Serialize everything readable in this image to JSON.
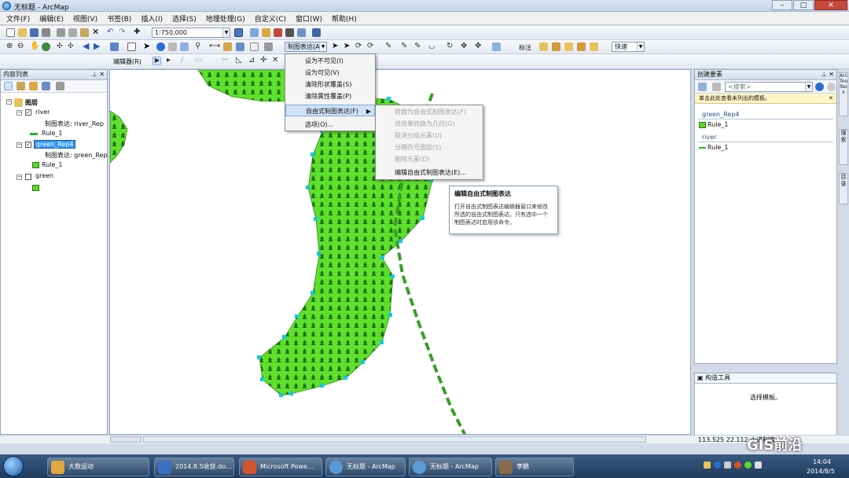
{
  "window": {
    "title": "无标题 - ArcMap"
  },
  "menu": [
    "文件(F)",
    "编辑(E)",
    "视图(V)",
    "书签(B)",
    "插入(I)",
    "选择(S)",
    "地理处理(G)",
    "自定义(C)",
    "窗口(W)",
    "帮助(H)"
  ],
  "toolbar1": {
    "scale": "1:750,000"
  },
  "toolbar2": {
    "representation_menu": "制图表达(A)",
    "label_menu": "标注",
    "label_combo": "快速"
  },
  "toolbar3": {
    "editor_menu": "编辑器(R)"
  },
  "toc": {
    "title": "内容列表",
    "layers_group": "图层",
    "items": [
      {
        "name": "river",
        "sub": "制图表达: river_Rep",
        "rule": "Rule_1",
        "checked": "✓"
      },
      {
        "name": "green_Rep4",
        "sub": "制图表达: green_Rep",
        "rule": "Rule_1",
        "checked": "✓"
      },
      {
        "name": "green",
        "checked": ""
      }
    ]
  },
  "dropdown": {
    "items": [
      "设为不可见(I)",
      "设为可见(V)",
      "清除形状覆盖(S)",
      "清除属性覆盖(P)",
      "自由式制图表达(F)",
      "选项(O)..."
    ]
  },
  "submenu": {
    "items": [
      "转换为自由式制图表达(F)",
      "将效果转换为几何(G)",
      "取消分组元素(U)",
      "分隔符号图层(S)",
      "删除元素(D)",
      "编辑自由式制图表达(E)..."
    ]
  },
  "tooltip": {
    "title": "编辑自由式制图表达",
    "body": "打开自由式制图表达编辑器窗口来修改所选的自由式制图表达。只有选中一个制图表达时启用该命令。"
  },
  "create_features": {
    "title": "创建要素",
    "search_placeholder": "<搜索>",
    "notice": "单击此处查看未列出的模板。",
    "groups": [
      {
        "name": "green_Rep4",
        "item": "Rule_1"
      },
      {
        "name": "river",
        "item": "Rule_1"
      }
    ]
  },
  "construct_tools": {
    "title": "构造工具",
    "hint": "选择模板。"
  },
  "side_tabs": [
    "ArcToolbox",
    "搜索",
    "目录"
  ],
  "status": {
    "coords": "113.525  22.112 十进制度"
  },
  "taskbar": {
    "items": [
      "大数运动",
      "2014.8.5收获.do...",
      "Microsoft Powe...",
      "无标题 - ArcMap",
      "无标题 - ArcMap",
      "李鹏"
    ],
    "time": "14:04",
    "date": "2014/8/5",
    "watermark": "GIS前沿"
  }
}
